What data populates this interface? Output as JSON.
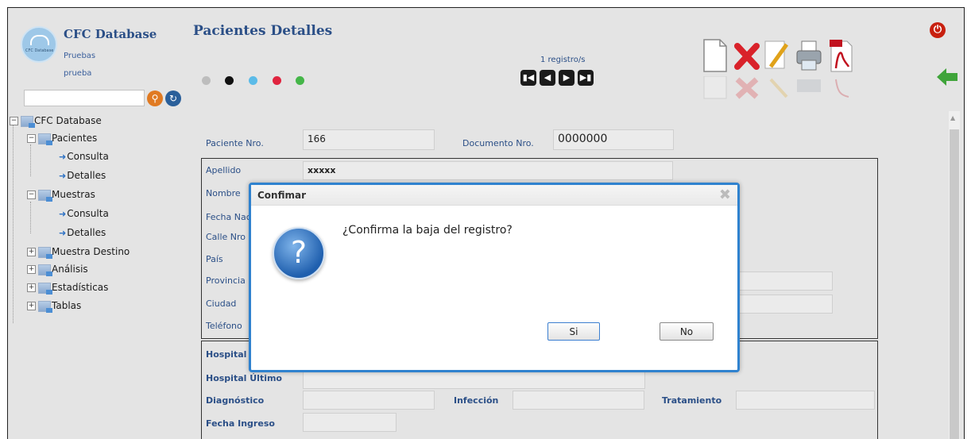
{
  "app": {
    "title": "CFC Database",
    "logo_text": "CFC Database",
    "sub1": "Pruebas",
    "sub2": "prueba"
  },
  "sidebar": {
    "search_value": "",
    "tree": [
      {
        "label": "CFC Database"
      },
      {
        "label": "Pacientes"
      },
      {
        "label": "Consulta"
      },
      {
        "label": "Detalles"
      },
      {
        "label": "Muestras"
      },
      {
        "label": "Consulta"
      },
      {
        "label": "Detalles"
      },
      {
        "label": "Muestra Destino"
      },
      {
        "label": "Análisis"
      },
      {
        "label": "Estadísticas"
      },
      {
        "label": "Tablas"
      }
    ]
  },
  "header": {
    "page_title": "Pacientes Detalles",
    "dots": [
      "#bdbdbd",
      "#111111",
      "#5bbbe8",
      "#e0243f",
      "#45b649"
    ],
    "record_count": "1 registro/s",
    "nav": [
      "first",
      "prev",
      "next",
      "last"
    ]
  },
  "toolbar": {
    "icons": [
      "new-document-icon",
      "delete-icon",
      "edit-icon",
      "print-icon",
      "pdf-icon"
    ]
  },
  "form": {
    "paciente_label": "Paciente Nro.",
    "paciente_value": "166",
    "documento_label": "Documento Nro.",
    "documento_value": "0000000",
    "apellido_label": "Apellido",
    "apellido_value": "xxxxx",
    "nombre_label": "Nombre",
    "fecha_nac_label": "Fecha Naci",
    "calle_label": "Calle Nro",
    "pais_label": "País",
    "provincia_label": "Provincia",
    "ciudad_label": "Ciudad",
    "telefono_label": "Teléfono",
    "hospital_label": "Hospital",
    "hospital_ultimo_label": "Hospital Último",
    "diagnostico_label": "Diagnóstico",
    "infeccion_label": "Infección",
    "tratamiento_label": "Tratamiento",
    "fecha_ingreso_label": "Fecha Ingreso"
  },
  "dialog": {
    "title": "Confimar",
    "message": "¿Confirma la baja del registro?",
    "yes": "Si",
    "no": "No"
  }
}
